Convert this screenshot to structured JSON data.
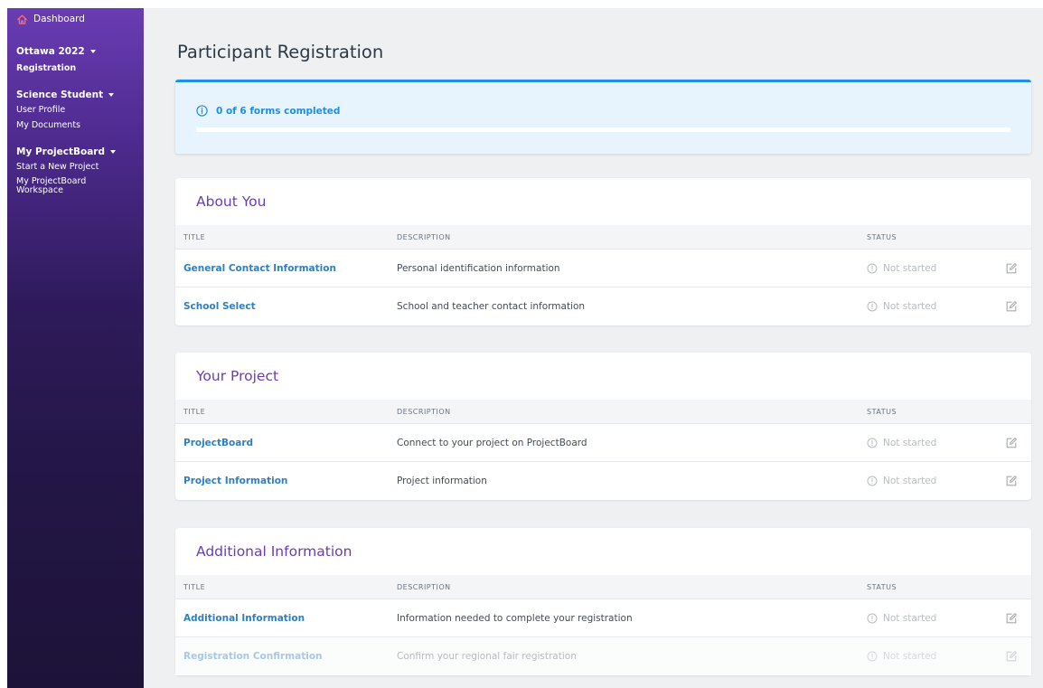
{
  "sidebar": {
    "dashboard": "Dashboard",
    "groups": [
      {
        "label": "Ottawa 2022",
        "items": [
          {
            "label": "Registration",
            "bold": true
          }
        ]
      },
      {
        "label": "Science Student",
        "items": [
          {
            "label": "User Profile"
          },
          {
            "label": "My Documents"
          }
        ]
      },
      {
        "label": "My ProjectBoard",
        "items": [
          {
            "label": "Start a New Project"
          },
          {
            "label": "My ProjectBoard Workspace"
          }
        ]
      }
    ]
  },
  "page": {
    "title": "Participant Registration"
  },
  "progress": {
    "text": "0 of 6 forms completed",
    "completed": 0,
    "total": 6
  },
  "columns": {
    "title": "TITLE",
    "description": "DESCRIPTION",
    "status": "STATUS"
  },
  "sections": [
    {
      "title": "About You",
      "rows": [
        {
          "title": "General Contact Information",
          "description": "Personal identification information",
          "status": "Not started"
        },
        {
          "title": "School Select",
          "description": "School and teacher contact information",
          "status": "Not started"
        }
      ]
    },
    {
      "title": "Your Project",
      "rows": [
        {
          "title": "ProjectBoard",
          "description": "Connect to your project on ProjectBoard",
          "status": "Not started"
        },
        {
          "title": "Project Information",
          "description": "Project information",
          "status": "Not started"
        }
      ]
    },
    {
      "title": "Additional Information",
      "rows": [
        {
          "title": "Additional Information",
          "description": "Information needed to complete your registration",
          "status": "Not started"
        },
        {
          "title": "Registration Confirmation",
          "description": "Confirm your regional fair registration",
          "status": "Not started",
          "disabled": true
        }
      ]
    }
  ],
  "icons": {
    "dashboard": "home-icon",
    "info": "info-circle-icon",
    "status": "clock-circle-icon",
    "edit": "edit-icon"
  },
  "colors": {
    "accent": "#6a3cb3",
    "link": "#2f7fc1",
    "progress": "#1e90e8",
    "home": "#ff6b5b"
  }
}
